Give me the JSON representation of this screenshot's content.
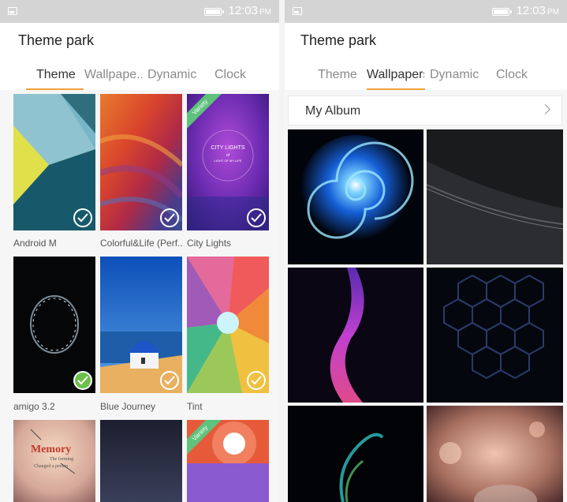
{
  "status": {
    "time": "12:03",
    "ampm": "PM"
  },
  "left": {
    "title": "Theme park",
    "tabs": [
      "Theme",
      "Wallpape..",
      "Dynamic",
      "Clock"
    ],
    "active_tab": "Theme",
    "themes": [
      {
        "label": "Android M",
        "applied": true
      },
      {
        "label": "Colorful&Life (Perf...",
        "applied": true
      },
      {
        "label": "City Lights",
        "applied": true,
        "badge": "Variety",
        "art_title": "CITY LIGHTS",
        "art_sub": "of",
        "art_sub2": "LIGHT OF MY LIFE"
      },
      {
        "label": "amigo 3.2",
        "applied": true,
        "current": true
      },
      {
        "label": "Blue Journey",
        "applied": true
      },
      {
        "label": "Tint",
        "applied": true
      },
      {
        "art_title": "Memory",
        "art_sub": "The forming",
        "art_sub2": "Changed a person"
      },
      {},
      {
        "badge": "Variety"
      }
    ]
  },
  "right": {
    "title": "Theme park",
    "tabs": [
      "Theme",
      "Wallpapers",
      "Dynamic",
      "Clock"
    ],
    "active_tab": "Wallpapers",
    "album_label": "My Album"
  },
  "colors": {
    "accent": "#f0a03c",
    "statusbar": "#d4d4d4",
    "badge_green": "#5ec27c",
    "current_green": "#6cc04a"
  },
  "icons": [
    "image-icon",
    "battery-icon",
    "check-icon",
    "chevron-right-icon"
  ]
}
